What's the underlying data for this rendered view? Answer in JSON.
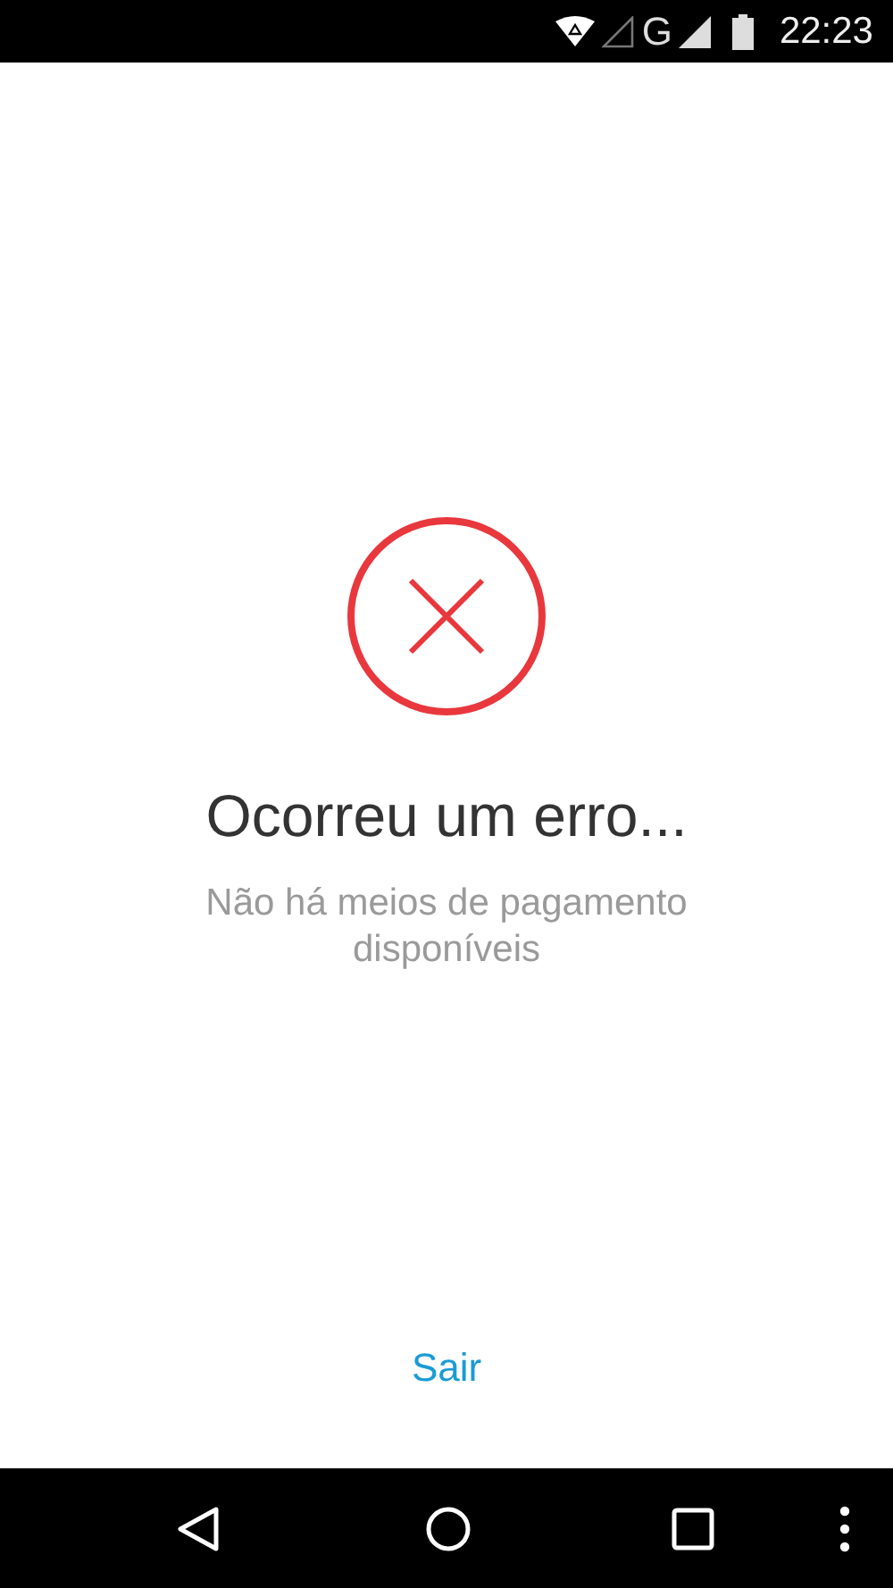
{
  "status_bar": {
    "network": "G",
    "time": "22:23"
  },
  "error": {
    "title": "Ocorreu um erro...",
    "message": "Não há meios de pagamento disponíveis"
  },
  "action": {
    "label": "Sair"
  }
}
